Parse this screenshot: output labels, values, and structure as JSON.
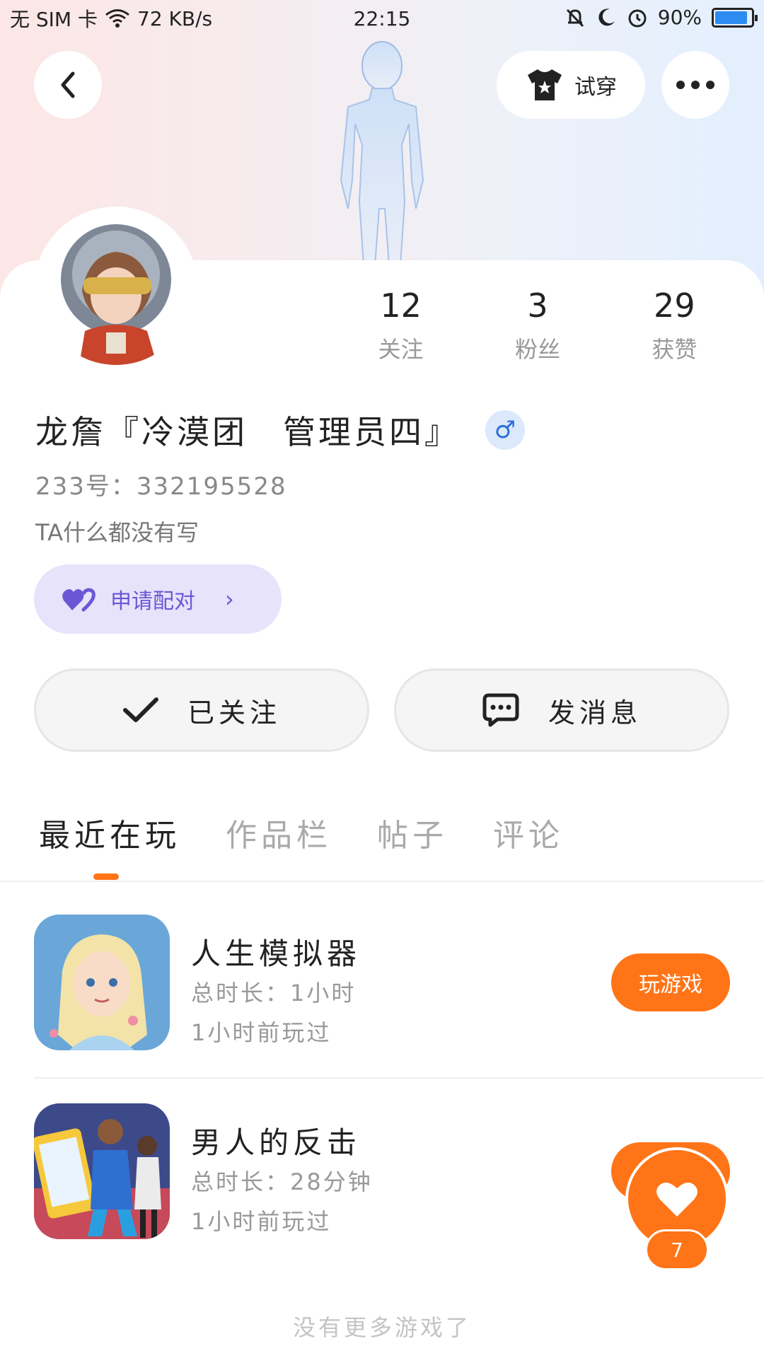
{
  "status_bar": {
    "carrier": "无 SIM 卡",
    "speed": "72 KB/s",
    "time": "22:15",
    "battery": "90%",
    "battery_level": 0.9
  },
  "header": {
    "tryon_label": "试穿"
  },
  "profile": {
    "stats": [
      {
        "value": "12",
        "label": "关注"
      },
      {
        "value": "3",
        "label": "粉丝"
      },
      {
        "value": "29",
        "label": "获赞"
      }
    ],
    "name": "龙詹『冷漠团　管理员四』",
    "gender_symbol": "♂",
    "uid": "233号：332195528",
    "bio": "TA什么都没有写",
    "pair_label": "申请配对",
    "follow_label": "已关注",
    "message_label": "发消息"
  },
  "tabs": [
    {
      "label": "最近在玩",
      "active": true
    },
    {
      "label": "作品栏",
      "active": false
    },
    {
      "label": "帖子",
      "active": false
    },
    {
      "label": "评论",
      "active": false
    }
  ],
  "games": [
    {
      "title": "人生模拟器",
      "duration": "总时长：1小时",
      "last_played": "1小时前玩过",
      "play_label": "玩游戏"
    },
    {
      "title": "男人的反击",
      "duration": "总时长：28分钟",
      "last_played": "1小时前玩过",
      "play_label": "玩游戏"
    }
  ],
  "floating_like": {
    "count": "7"
  },
  "footer_note": "没有更多游戏了",
  "colors": {
    "accent": "#ff7417",
    "pair_bg": "#e7e3fb",
    "pair_text": "#6b57d6"
  }
}
